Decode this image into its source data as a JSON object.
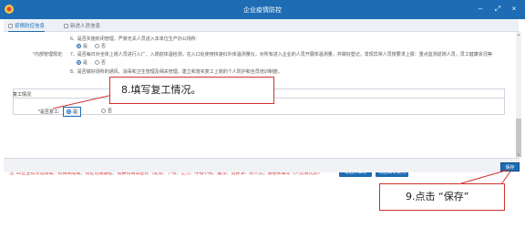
{
  "window": {
    "title": "企业疫情防控",
    "controls": {
      "minimize": "–",
      "maximize": "⤢",
      "close": "×"
    }
  },
  "tabs": [
    {
      "label": "疫情防控信息",
      "active": true
    },
    {
      "label": "新进人员信息",
      "active": false
    }
  ],
  "content": {
    "item6": "6、是否实施封闭管理，严禁无关人员进入本单位生产办公场所:",
    "item6_opts": {
      "yes": "是",
      "no": "否"
    },
    "measures_label": "*内部管理规定:",
    "item7": "7、是否每日对全体上岗人员进行入厂、入岗前体温检测，在入口处使用快速红外体温测量仪，对所有进入企业的人员开展体温测量，并做好登记，发现异常人员按要求上报：重点监测返岗人员，员工健康状况等:",
    "item7_opts": {
      "yes": "是",
      "no": "否"
    },
    "item8": "8、是否做好场所的通风、消毒和卫生管理及相关管理，建立和落实复工上岗的个人防护和全员培训制度。",
    "section_title": "复工情况",
    "return_label": "*是否复工:",
    "return_options": {
      "yes": "是",
      "no": "否",
      "selected": "yes"
    },
    "notice": "注: 02企业有涉及隔离、有相关隔离、有密切接触者、观察有相似症状（发热、干咳、乏力、呼吸不畅、腹泻、流鼻涕）的人员，请继续填写《人员情况表》",
    "btn_fill_personnel": "勾选并填写",
    "btn_fill_notes": "勾选填写说明"
  },
  "footer": {
    "save_label": "保存"
  },
  "callouts": {
    "step8": "8.填写复工情况。",
    "step9": "9.点击 “保存”"
  },
  "colors": {
    "accent": "#1d6cb4",
    "annotation": "#d23030"
  }
}
